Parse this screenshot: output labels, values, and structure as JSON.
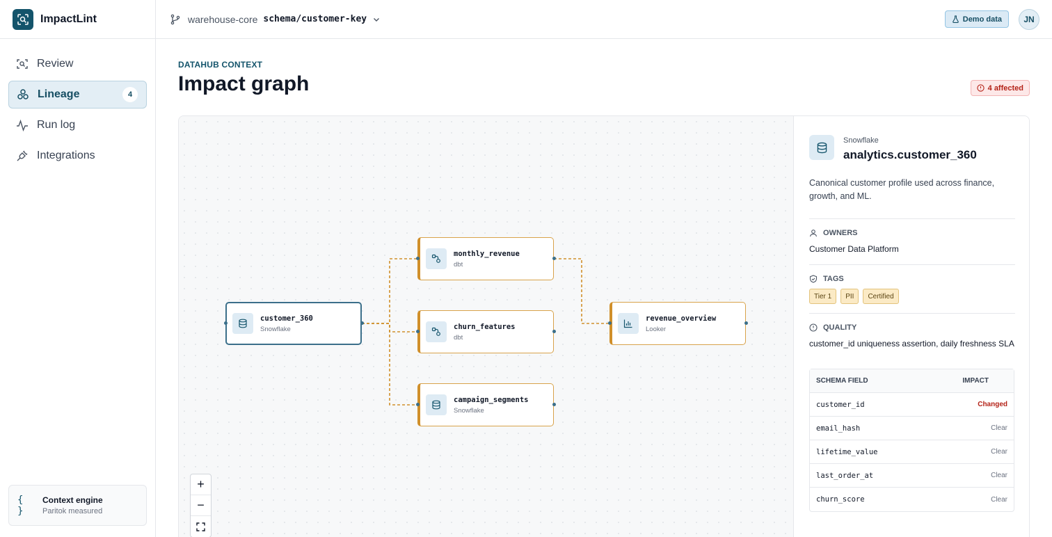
{
  "app": {
    "name": "ImpactLint"
  },
  "sidebar": {
    "items": [
      {
        "label": "Review",
        "icon": "scan-icon"
      },
      {
        "label": "Lineage",
        "icon": "lineage-icon",
        "badge": "4",
        "active": true
      },
      {
        "label": "Run log",
        "icon": "activity-icon"
      },
      {
        "label": "Integrations",
        "icon": "plug-icon"
      }
    ],
    "engine": {
      "icon": "{ }",
      "title": "Context engine",
      "subtitle": "Paritok measured"
    }
  },
  "topbar": {
    "repo": "warehouse-core",
    "branch": "schema/customer-key",
    "demo_label": "Demo data",
    "avatar_initials": "JN"
  },
  "main": {
    "eyebrow": "DATAHUB CONTEXT",
    "title": "Impact graph",
    "affected_label": "4 affected"
  },
  "graph": {
    "nodes": {
      "customer_360": {
        "name": "customer_360",
        "platform": "Snowflake"
      },
      "monthly_revenue": {
        "name": "monthly_revenue",
        "platform": "dbt"
      },
      "churn_features": {
        "name": "churn_features",
        "platform": "dbt"
      },
      "campaign_segments": {
        "name": "campaign_segments",
        "platform": "Snowflake"
      },
      "revenue_overview": {
        "name": "revenue_overview",
        "platform": "Looker"
      }
    },
    "zoom": {
      "in": "+",
      "out": "−",
      "fit": "fit-screen-icon"
    }
  },
  "details": {
    "platform": "Snowflake",
    "name": "analytics.customer_360",
    "description": "Canonical customer profile used across finance, growth, and ML.",
    "owners_label": "OWNERS",
    "owners": "Customer Data Platform",
    "tags_label": "TAGS",
    "tags": [
      "Tier 1",
      "PII",
      "Certified"
    ],
    "quality_label": "QUALITY",
    "quality": "customer_id uniqueness assertion, daily freshness SLA",
    "schema": {
      "col_field": "SCHEMA FIELD",
      "col_impact": "IMPACT",
      "rows": [
        {
          "field": "customer_id",
          "impact": "Changed"
        },
        {
          "field": "email_hash",
          "impact": "Clear"
        },
        {
          "field": "lifetime_value",
          "impact": "Clear"
        },
        {
          "field": "last_order_at",
          "impact": "Clear"
        },
        {
          "field": "churn_score",
          "impact": "Clear"
        }
      ]
    }
  },
  "colors": {
    "brand": "#14546b",
    "impacted": "#d08f2a",
    "changed": "#b42318"
  }
}
